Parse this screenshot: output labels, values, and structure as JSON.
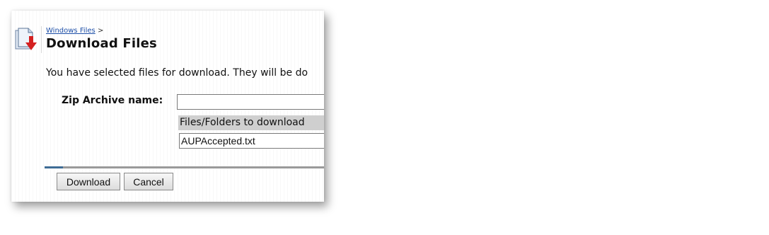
{
  "header": {
    "breadcrumb_link": "Windows Files",
    "breadcrumb_separator": ">",
    "title": "Download Files",
    "icon": "file-download-icon"
  },
  "intro": {
    "text": "You have selected files for download. They will be do"
  },
  "form": {
    "zip_label": "Zip Archive name:",
    "zip_value": "",
    "files_header": "Files/Folders to download",
    "files": [
      "AUPAccepted.txt"
    ]
  },
  "buttons": {
    "download": "Download",
    "cancel": "Cancel"
  },
  "colors": {
    "link": "#1d4fa8",
    "header_bg": "#cfcfcf",
    "divider": "#9a9a9a",
    "divider_accent": "#3e6c95",
    "icon_arrow": "#d42020"
  }
}
